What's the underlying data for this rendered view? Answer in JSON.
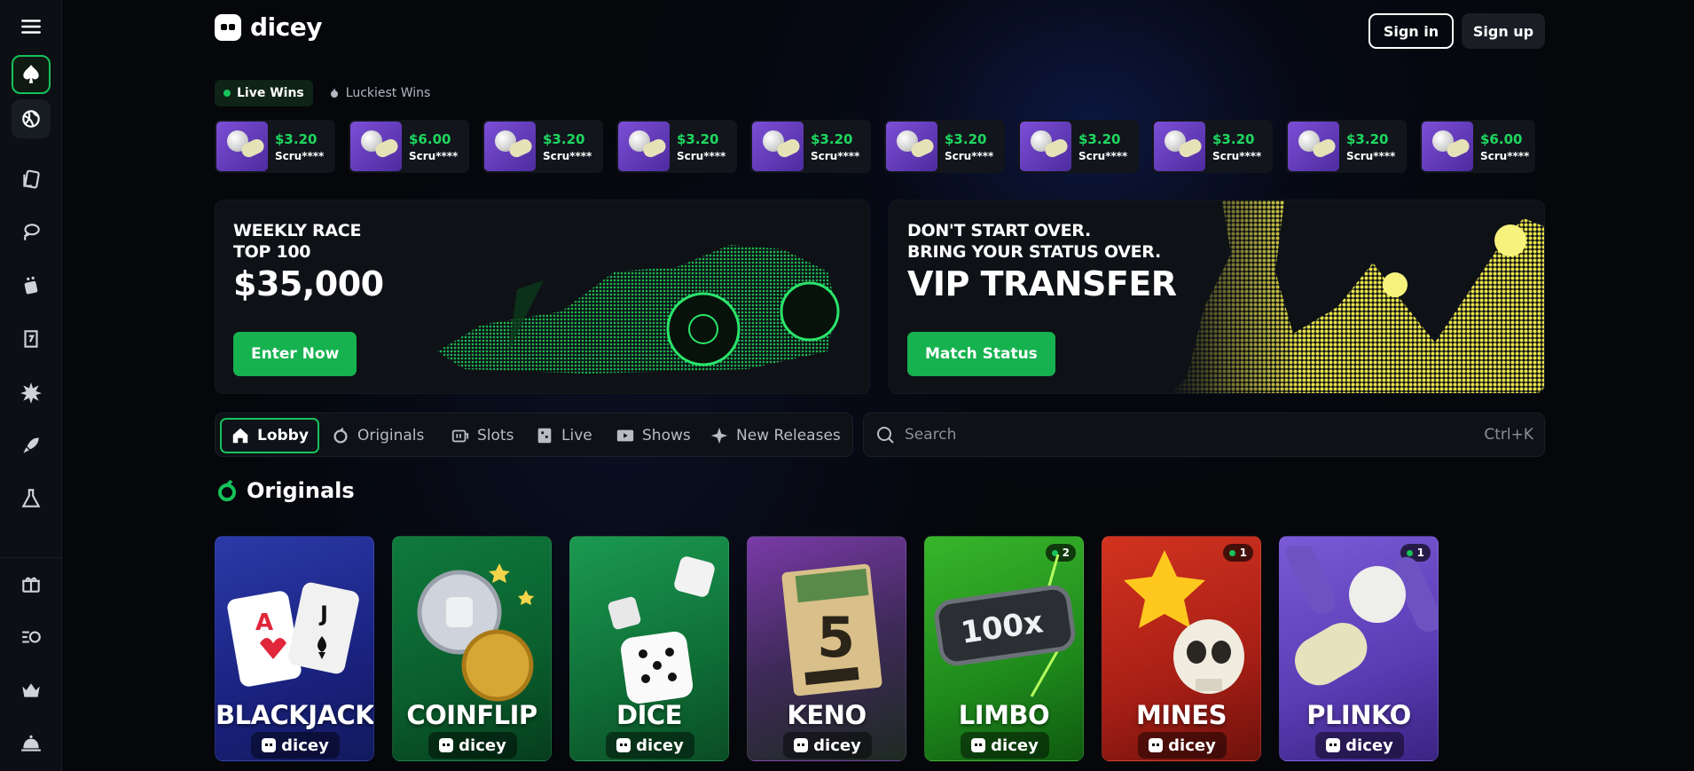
{
  "brand": {
    "name": "dicey"
  },
  "header": {
    "signin_label": "Sign in",
    "signup_label": "Sign up"
  },
  "sidebar": {
    "items": [
      {
        "icon": "menu-icon"
      },
      {
        "icon": "spade-icon",
        "active": true
      },
      {
        "icon": "sports-ball-icon"
      },
      {
        "icon": "cards-icon"
      },
      {
        "icon": "lasso-icon"
      },
      {
        "icon": "dice-icon"
      },
      {
        "icon": "slot-icon"
      },
      {
        "icon": "burst-icon"
      },
      {
        "icon": "rocket-icon"
      },
      {
        "icon": "flask-icon"
      },
      {
        "icon": "gift-icon"
      },
      {
        "icon": "coin-stack-icon"
      },
      {
        "icon": "crown-icon"
      },
      {
        "icon": "bell-icon"
      }
    ]
  },
  "wins": {
    "tabs": [
      {
        "label": "Live Wins",
        "active": true
      },
      {
        "label": "Luckiest Wins",
        "active": false
      }
    ],
    "cards": [
      {
        "amount": "$3.20",
        "user": "Scru****"
      },
      {
        "amount": "$6.00",
        "user": "Scru****"
      },
      {
        "amount": "$3.20",
        "user": "Scru****"
      },
      {
        "amount": "$3.20",
        "user": "Scru****"
      },
      {
        "amount": "$3.20",
        "user": "Scru****"
      },
      {
        "amount": "$3.20",
        "user": "Scru****"
      },
      {
        "amount": "$3.20",
        "user": "Scru****"
      },
      {
        "amount": "$3.20",
        "user": "Scru****"
      },
      {
        "amount": "$3.20",
        "user": "Scru****"
      },
      {
        "amount": "$6.00",
        "user": "Scru****"
      }
    ]
  },
  "banners": {
    "race": {
      "line1": "WEEKLY RACE",
      "line2": "TOP 100",
      "title": "$35,000",
      "button": "Enter Now"
    },
    "vip": {
      "line1": "DON'T START OVER.",
      "line2": "BRING YOUR STATUS OVER.",
      "title": "VIP TRANSFER",
      "button": "Match Status"
    }
  },
  "nav": {
    "tabs": [
      {
        "label": "Lobby",
        "icon": "home-icon",
        "active": true
      },
      {
        "label": "Originals",
        "icon": "originals-icon"
      },
      {
        "label": "Slots",
        "icon": "slots-icon"
      },
      {
        "label": "Live",
        "icon": "live-icon"
      },
      {
        "label": "Shows",
        "icon": "shows-icon"
      },
      {
        "label": "New Releases",
        "icon": "sparkle-icon"
      }
    ]
  },
  "search": {
    "placeholder": "Search",
    "shortcut": "Ctrl+K"
  },
  "originals": {
    "title": "Originals",
    "games": [
      {
        "name": "BLACKJACK",
        "brand": "dicey",
        "badge": ""
      },
      {
        "name": "COINFLIP",
        "brand": "dicey",
        "badge": ""
      },
      {
        "name": "DICE",
        "brand": "dicey",
        "badge": ""
      },
      {
        "name": "KENO",
        "brand": "dicey",
        "badge": ""
      },
      {
        "name": "LIMBO",
        "brand": "dicey",
        "badge": "2"
      },
      {
        "name": "MINES",
        "brand": "dicey",
        "badge": "1"
      },
      {
        "name": "PLINKO",
        "brand": "dicey",
        "badge": "1"
      }
    ]
  },
  "colors": {
    "accent": "#16c25a",
    "win_amount": "#1ed760",
    "background": "#05070b",
    "panel": "#0e1116"
  }
}
